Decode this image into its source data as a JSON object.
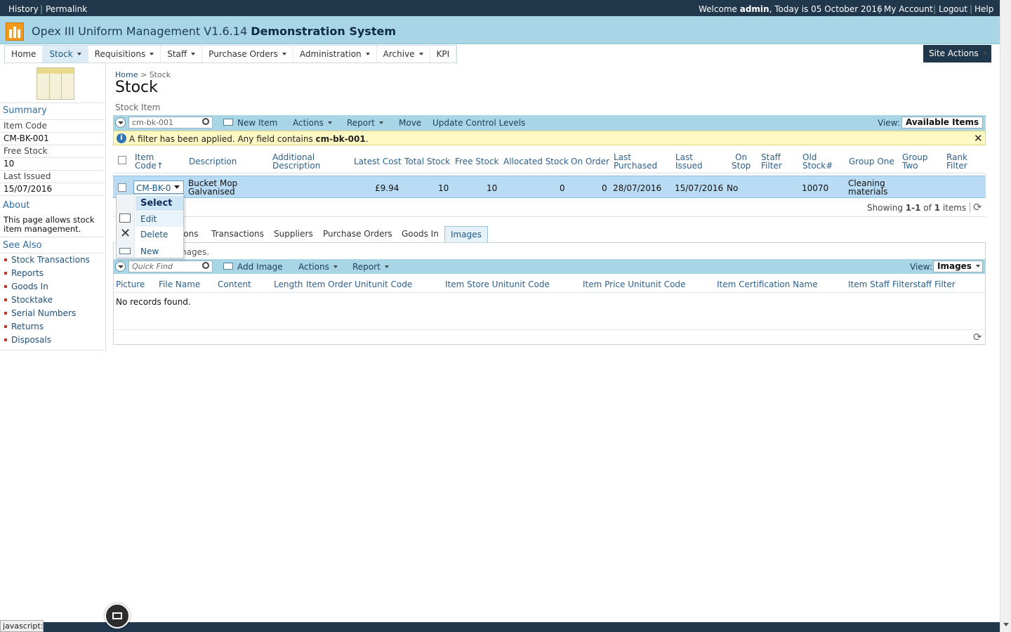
{
  "topbar": {
    "history": "History",
    "permalink": "Permalink",
    "welcome_prefix": "Welcome",
    "user": "admin",
    "today_text": ", Today is 05 October 2016",
    "my_account": "My Account",
    "logout": "Logout",
    "help": "Help"
  },
  "app": {
    "title": "Opex III Uniform Management V1.6.14",
    "system": "Demonstration System"
  },
  "nav": {
    "items": [
      "Home",
      "Stock",
      "Requisitions",
      "Staff",
      "Purchase Orders",
      "Administration",
      "Archive",
      "KPI"
    ],
    "selected": "Stock",
    "site_actions": "Site Actions"
  },
  "left": {
    "summary": "Summary",
    "item_code_label": "Item Code",
    "item_code": "CM-BK-001",
    "free_stock_label": "Free Stock",
    "free_stock": "10",
    "last_issued_label": "Last Issued",
    "last_issued": "15/07/2016",
    "about": "About",
    "about_text_1": "This page allows stock",
    "about_text_2": "item management.",
    "see_also": "See Also",
    "links": [
      "Stock Transactions",
      "Reports",
      "Goods In",
      "Stocktake",
      "Serial Numbers",
      "Returns",
      "Disposals"
    ]
  },
  "page": {
    "breadcrumb_home": "Home",
    "breadcrumb_sep": ">",
    "breadcrumb_current": "Stock",
    "title": "Stock",
    "section": "Stock Item"
  },
  "grid": {
    "search_value": "cm-bk-001",
    "new_item": "New Item",
    "actions": "Actions",
    "report": "Report",
    "move": "Move",
    "update_levels": "Update Control Levels",
    "view_label": "View:",
    "view_value": "Available Items",
    "filter_prefix": "A filter has been applied. Any field contains",
    "filter_value": "cm-bk-001",
    "filter_suffix": ".",
    "columns": {
      "item_code_1": "Item",
      "item_code_2": "Code",
      "description": "Description",
      "addl_1": "Additional",
      "addl_2": "Description",
      "latest_cost": "Latest Cost",
      "total_stock": "Total Stock",
      "free_stock": "Free Stock",
      "allocated": "Allocated Stock",
      "on_order": "On Order",
      "last_purchased_1": "Last",
      "last_purchased_2": "Purchased",
      "last_issued_1": "Last",
      "last_issued_2": "Issued",
      "on_stop_1": "On",
      "on_stop_2": "Stop",
      "staff_filter_1": "Staff",
      "staff_filter_2": "Filter",
      "old_stock_1": "Old",
      "old_stock_2": "Stock#",
      "group_one": "Group One",
      "group_two_1": "Group",
      "group_two_2": "Two",
      "rank_filter_1": "Rank",
      "rank_filter_2": "Filter"
    },
    "row": {
      "item_code": "CM-BK-0",
      "description_1": "Bucket Mop",
      "description_2": "Galvanised",
      "latest_cost": "£9.94",
      "total_stock": "10",
      "free_stock": "10",
      "allocated": "0",
      "on_order": "0",
      "last_purchased": "28/07/2016",
      "last_issued": "15/07/2016",
      "on_stop": "No",
      "old_stock": "10070",
      "group_one_1": "Cleaning",
      "group_one_2": "materials"
    },
    "showing_prefix": "Showing",
    "showing_range": "1-1",
    "showing_of": "of",
    "showing_total": "1",
    "showing_suffix": "items"
  },
  "context_menu": {
    "select": "Select",
    "edit": "Edit",
    "delete": "Delete",
    "new": "New"
  },
  "tabs": {
    "partial_first": "ions",
    "items": [
      "Transactions",
      "Suppliers",
      "Purchase Orders",
      "Goods In",
      "Images"
    ],
    "selected": "Images",
    "partial_desc": "nages."
  },
  "images_grid": {
    "quick_find_placeholder": "Quick Find",
    "add_image": "Add Image",
    "actions": "Actions",
    "report": "Report",
    "view_label": "View:",
    "view_value": "Images",
    "columns": [
      "Picture",
      "File Name",
      "Content",
      "Length",
      "Item Order Unitunit Code",
      "Item Store Unitunit Code",
      "Item Price Unitunit Code",
      "Item Certification Name",
      "Item Staff Filterstaff Filter"
    ],
    "empty": "No records found."
  },
  "status": {
    "text": "javascript:"
  }
}
